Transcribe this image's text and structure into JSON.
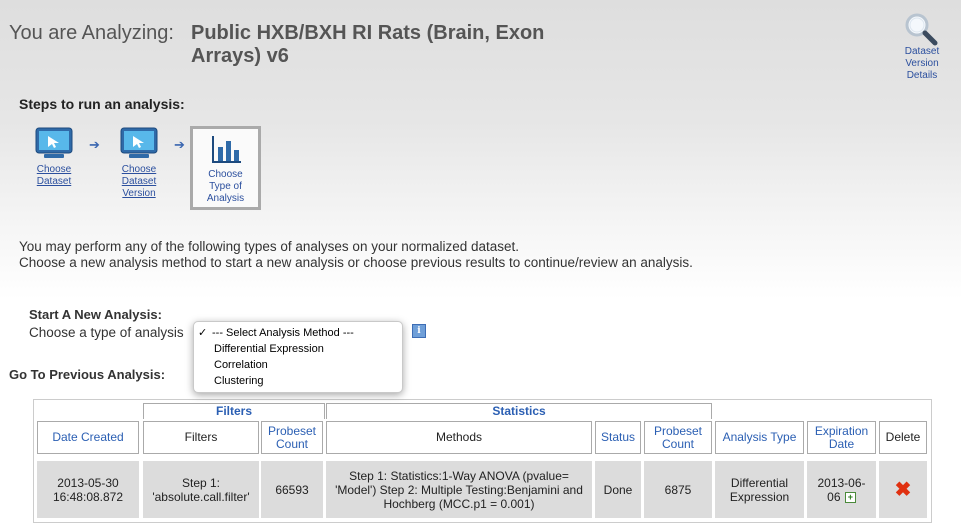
{
  "header": {
    "prefix": "You are Analyzing:",
    "dataset_title": "Public HXB/BXH RI Rats (Brain, Exon Arrays) v6",
    "details_link": [
      "Dataset",
      "Version",
      "Details"
    ]
  },
  "steps": {
    "heading": "Steps to run an analysis:",
    "items": [
      {
        "label": [
          "Choose",
          "Dataset"
        ],
        "icon": "monitor-cursor-icon"
      },
      {
        "label": [
          "Choose",
          "Dataset",
          "Version"
        ],
        "icon": "monitor-cursor-icon"
      },
      {
        "label": [
          "Choose",
          "Type of",
          "Analysis"
        ],
        "icon": "bar-chart-icon"
      }
    ]
  },
  "intro": [
    "You may perform any of the following types of analyses on your normalized dataset.",
    "Choose a new analysis method to start a new analysis or choose previous results to continue/review an analysis."
  ],
  "new_analysis": {
    "heading": "Start A New Analysis:",
    "prompt": "Choose a type of analysis",
    "options": [
      "--- Select Analysis Method ---",
      "Differential Expression",
      "Correlation",
      "Clustering"
    ],
    "selected": "--- Select Analysis Method ---",
    "info_icon": "i"
  },
  "previous": {
    "heading": "Go To Previous Analysis:",
    "groups": {
      "filters": "Filters",
      "statistics": "Statistics"
    },
    "columns": [
      "Date Created",
      "Filters",
      "Probeset Count",
      "Methods",
      "Status",
      "Probeset Count",
      "Analysis Type",
      "Expiration Date",
      "Delete"
    ],
    "rows": [
      {
        "date_created": "2013-05-30 16:48:08.872",
        "filters": "Step 1: 'absolute.call.filter'",
        "filter_count": "66593",
        "methods": "Step 1: Statistics:1-Way ANOVA (pvalue= 'Model') Step 2: Multiple Testing:Benjamini and Hochberg (MCC.p1 = 0.001)",
        "status": "Done",
        "stat_count": "6875",
        "analysis_type": "Differential Expression",
        "expiration": "2013-06-06"
      }
    ]
  },
  "colors": {
    "link": "#2b4f9e",
    "delete": "#e03010"
  }
}
